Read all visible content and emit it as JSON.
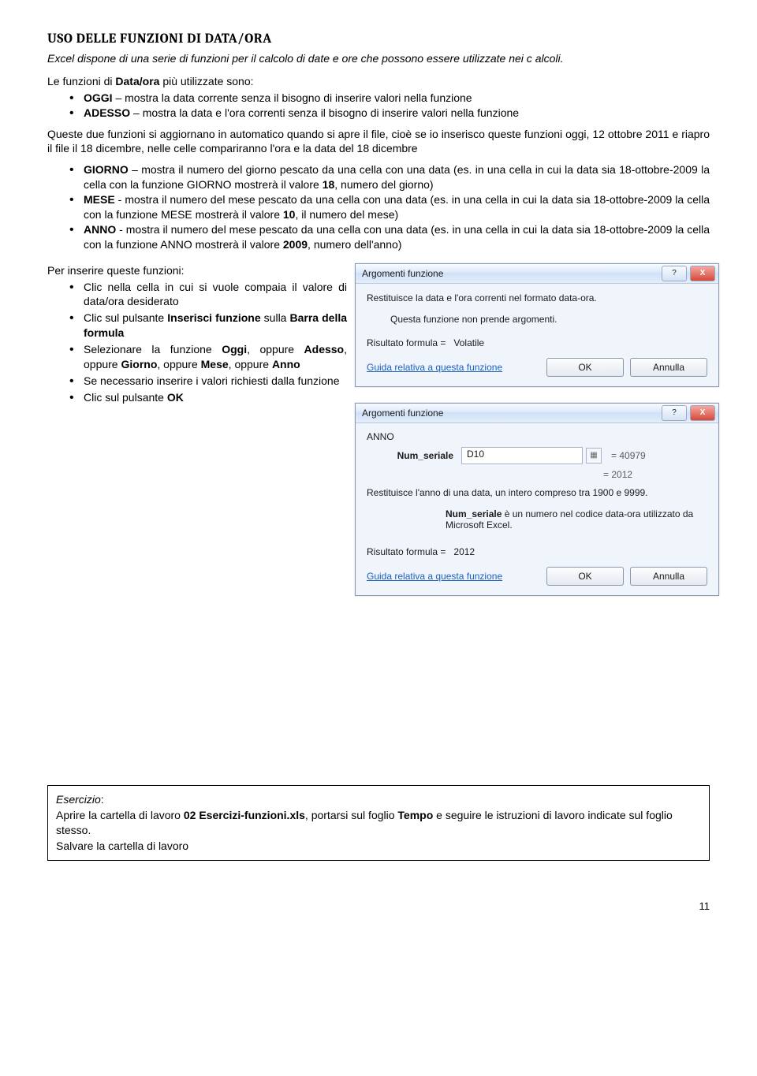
{
  "heading": "USO DELLE  FUNZIONI DI DATA/ORA",
  "intro": "Excel dispone di una serie di funzioni per il calcolo di date e ore che possono essere utilizzate nei c alcoli.",
  "lead1a": "Le funzioni di ",
  "lead1b": "Data/ora",
  "lead1c": " più utilizzate sono:",
  "funcs": {
    "oggi_b": "OGGI",
    "oggi_t": " – mostra la data corrente senza il bisogno di inserire valori nella funzione",
    "adesso_b": "ADESSO",
    "adesso_t": " – mostra la data e l'ora correnti senza il bisogno di inserire valori nella funzione"
  },
  "afterlist": "Queste due funzioni si aggiornano in automatico quando si apre il file, cioè se io inserisco queste funzioni oggi, 12 ottobre 2011 e riapro il file il 18 dicembre, nelle celle compariranno l'ora e la data del 18 dicembre",
  "funcs2": {
    "giorno_b": "GIORNO",
    "giorno_t1": " – mostra il numero del giorno pescato da una cella con una data (es. in una cella in cui la data sia 18-ottobre-2009 la cella con la funzione GIORNO mostrerà il valore ",
    "giorno_val": "18",
    "giorno_t2": ", numero del giorno)",
    "mese_b": "MESE",
    "mese_t1": " - mostra il numero del mese pescato da una cella con una data (es. in una cella in cui la data sia 18-ottobre-2009 la cella con la funzione MESE mostrerà il valore ",
    "mese_val": "10",
    "mese_t2": ", il numero del mese)",
    "anno_b": "ANNO",
    "anno_t1": " - mostra il numero del mese pescato da una cella con una data (es. in una cella in cui la data sia 18-ottobre-2009 la cella con la funzione ANNO mostrerà il valore ",
    "anno_val": "2009",
    "anno_t2": ", numero dell'anno)"
  },
  "insert_lead": "Per inserire queste funzioni:",
  "steps": {
    "s1": "Clic nella cella in cui si vuole compaia il valore di data/ora desiderato",
    "s2a": "Clic sul pulsante ",
    "s2b": "Inserisci funzione",
    "s2c": " sulla ",
    "s2d": "Barra della formula",
    "s3a": "Selezionare la funzione ",
    "s3b": "Oggi",
    "s3c": ", oppure ",
    "s3d": "Adesso",
    "s3e": ", oppure ",
    "s3f": "Giorno",
    "s3g": ", oppure ",
    "s3h": "Mese",
    "s3i": ", oppure ",
    "s3j": "Anno",
    "s4": "Se necessario inserire i valori richiesti dalla funzione",
    "s5a": "Clic sul pulsante ",
    "s5b": "OK"
  },
  "dlg1": {
    "title": "Argomenti funzione",
    "desc": "Restituisce la data e l'ora correnti nel formato data-ora.",
    "sub": "Questa funzione non prende argomenti.",
    "result_label": "Risultato formula =",
    "result_val": "Volatile",
    "help": "Guida relativa a questa funzione",
    "ok": "OK",
    "cancel": "Annulla",
    "close_x": "X",
    "help_q": "?"
  },
  "dlg2": {
    "title": "Argomenti funzione",
    "func": "ANNO",
    "arg": "Num_seriale",
    "argval": "D10",
    "eqarg": "=  40979",
    "eqres": "=  2012",
    "desc": "Restituisce l'anno di una data, un intero compreso tra 1900 e 9999.",
    "argdesc_b": "Num_seriale",
    "argdesc_t": "  è un numero nel codice data-ora utilizzato da Microsoft Excel.",
    "result_label": "Risultato formula =",
    "result_val": "2012",
    "help": "Guida relativa a questa funzione",
    "ok": "OK",
    "cancel": "Annulla",
    "close_x": "X",
    "help_q": "?",
    "ref_icon": "▦"
  },
  "exercise": {
    "label": "Esercizio",
    "colon": ":",
    "line1a": "Aprire la cartella di lavoro ",
    "line1b": "02 Esercizi-funzioni.xls",
    "line1c": ", portarsi sul foglio ",
    "line1d": "Tempo",
    "line1e": " e seguire le istruzioni di lavoro indicate sul foglio stesso.",
    "line2": "Salvare la cartella di lavoro"
  },
  "pagenum": "11"
}
